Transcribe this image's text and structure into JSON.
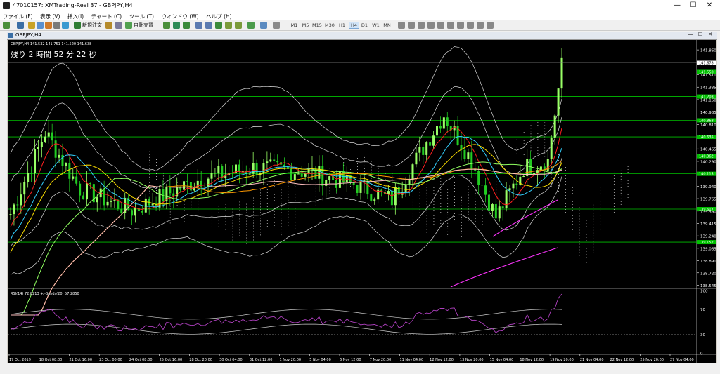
{
  "window": {
    "title": "47010157: XMTrading-Real 37 - GBPJPY,H4",
    "minimize": "—",
    "maximize": "☐",
    "close": "✕"
  },
  "menu": [
    "ファイル (F)",
    "表示 (V)",
    "挿入(I)",
    "チャート (C)",
    "ツール (T)",
    "ウィンドウ (W)",
    "ヘルプ (H)"
  ],
  "toolbar": {
    "new_order_label": "新規注文",
    "auto_trade_label": "自動売買",
    "timeframes": [
      "M1",
      "M5",
      "M15",
      "M30",
      "H1",
      "H4",
      "D1",
      "W1",
      "MN"
    ],
    "selected_timeframe": "H4"
  },
  "chart_window": {
    "title": "GBPJPY,H4"
  },
  "chart": {
    "info_line": "GBPJPY,H4  141.532 141.751 141.520 141.638",
    "countdown": "残り 2 時間 52 分 22 秒",
    "price_axis": [
      "141.860",
      "141.678",
      "141.510",
      "141.335",
      "141.160",
      "140.985",
      "140.810",
      "140.635",
      "140.465",
      "140.290",
      "140.115",
      "139.940",
      "139.765",
      "139.590",
      "139.415",
      "139.240",
      "139.065",
      "138.890",
      "138.720",
      "138.545"
    ],
    "current_price": "141.678",
    "level_labels": [
      "141.550",
      "141.203",
      "140.868",
      "140.635",
      "140.362",
      "140.115",
      "139.617",
      "139.152"
    ],
    "time_axis": [
      "17 Oct 2019",
      "18 Oct 08:00",
      "21 Oct 16:00",
      "23 Oct 00:00",
      "24 Oct 08:00",
      "25 Oct 16:00",
      "28 Oct 20:00",
      "30 Oct 04:00",
      "31 Oct 12:00",
      "1 Nov 20:00",
      "5 Nov 04:00",
      "6 Nov 12:00",
      "7 Nov 20:00",
      "11 Nov 04:00",
      "12 Nov 12:00",
      "13 Nov 20:00",
      "15 Nov 04:00",
      "18 Nov 12:00",
      "19 Nov 20:00",
      "21 Nov 04:00",
      "22 Nov 12:00",
      "25 Nov 20:00",
      "27 Nov 04:00"
    ],
    "rsi_label": "RSI(14) 72.8213   +/-Bands(20) 57.2850",
    "rsi_axis": [
      "100",
      "70",
      "30",
      "0"
    ]
  },
  "colors": {
    "bg": "#000000",
    "candle_up": "#99ff66",
    "candle_down": "#22cc22",
    "level": "#00c000",
    "bollinger": "#d8d8d8",
    "ma_red": "#ff2020",
    "ma_cyan": "#33d0ff",
    "ma_yellow": "#ffe000",
    "ma_orange": "#ff9900",
    "ma_lightgreen": "#90ff60",
    "ma_pink": "#ffc0c0",
    "ma_magenta": "#ff33ff",
    "ichimoku": "#ffffff"
  }
}
